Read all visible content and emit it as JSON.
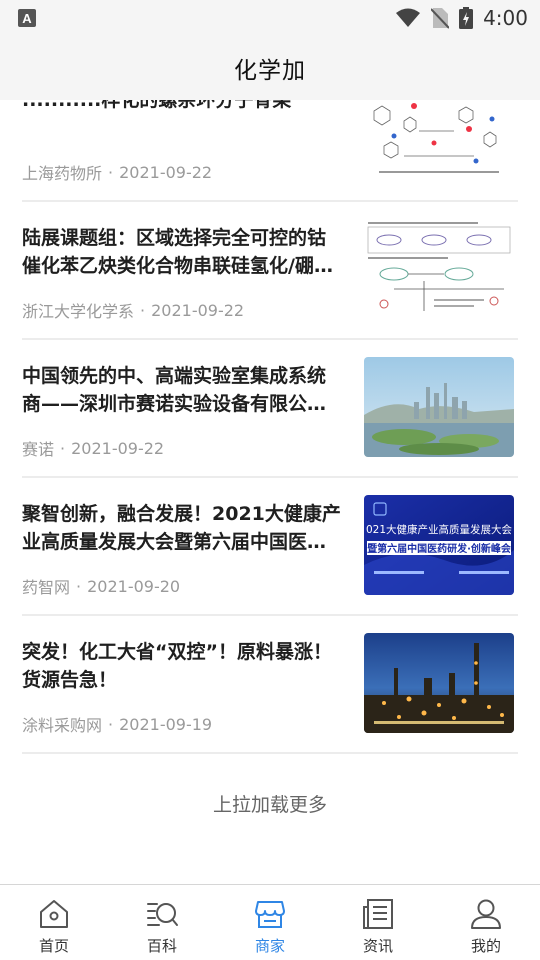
{
  "status_bar": {
    "time": "4:00"
  },
  "header": {
    "title": "化学加"
  },
  "articles": [
    {
      "headline": "...........样化的螺杂环分子骨架",
      "source": "上海药物所",
      "separator": "·",
      "date": "2021-09-22",
      "thumb": "scheme-icon"
    },
    {
      "headline": "陆展课题组：区域选择完全可控的钴催化苯乙炔类化合物串联硅氢化/硼…",
      "source": "浙江大学化学系",
      "separator": "·",
      "date": "2021-09-22",
      "thumb": "reaction-diagram-icon"
    },
    {
      "headline": "中国领先的中、高端实验室集成系统商——深圳市赛诺实验设备有限公…",
      "source": "赛诺",
      "separator": "·",
      "date": "2021-09-22",
      "thumb": "city-photo-icon"
    },
    {
      "headline": "聚智创新，融合发展！2021大健康产业高质量发展大会暨第六届中国医…",
      "source": "药智网",
      "separator": "·",
      "date": "2021-09-20",
      "thumb": "conference-banner-icon"
    },
    {
      "headline": "突发！化工大省“双控”！原料暴涨！货源告急！",
      "source": "涂料采购网",
      "separator": "·",
      "date": "2021-09-19",
      "thumb": "factory-night-icon"
    }
  ],
  "banner_text": {
    "line1": "021大健康产业高质量发展大会",
    "line2": "暨第六届中国医药研发·创新峰会"
  },
  "load_more": "上拉加载更多",
  "tabs": [
    {
      "label": "首页",
      "icon": "home-icon",
      "active": false
    },
    {
      "label": "百科",
      "icon": "encyclopedia-search-icon",
      "active": false
    },
    {
      "label": "商家",
      "icon": "store-icon",
      "active": true
    },
    {
      "label": "资讯",
      "icon": "news-icon",
      "active": false
    },
    {
      "label": "我的",
      "icon": "profile-icon",
      "active": false
    }
  ],
  "colors": {
    "accent": "#2f86e5",
    "muted": "#9a9a9a",
    "bar_bg": "#f5f5f5"
  }
}
